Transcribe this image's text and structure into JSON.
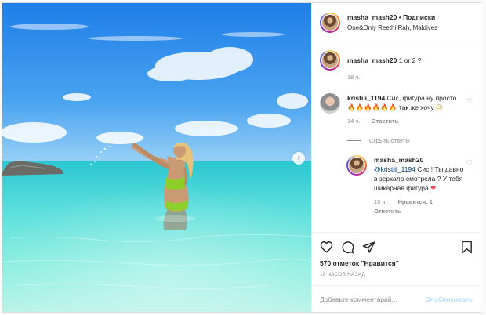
{
  "header": {
    "username": "masha_mash20",
    "separator": "•",
    "follow_label": "Подписки",
    "location": "One&Only Reethi Rah, Maldives"
  },
  "caption": {
    "username": "masha_mash20",
    "text": "1 or 2 ?",
    "time": "18 ч."
  },
  "comments": [
    {
      "username": "kristiii_1194",
      "text_before": "Сис, фигура ну просто",
      "emoji": "🔥🔥🔥🔥🔥🔥",
      "text_after": "так же хочу",
      "emoji_end": "😉",
      "time": "14 ч.",
      "reply_label": "Ответить"
    }
  ],
  "replies_toggle": "Скрыть ответы",
  "reply": {
    "username": "masha_mash20",
    "mention": "@kristiii_1194",
    "text": "Сис ! Ты давно в зеркало смотрела ? У тебя шикарная фигура",
    "emoji": "❤",
    "time": "15 ч.",
    "likes_label": "Нравится: 1",
    "reply_label": "Ответить"
  },
  "likes_text": "570 отметок \"Нравится\"",
  "post_time": "18 ЧАСОВ НАЗАД",
  "add_comment": {
    "placeholder": "Добавьте комментарий...",
    "publish_label": "Опубликовать"
  },
  "icons": {
    "like": "heart-icon",
    "comment": "comment-icon",
    "share": "share-icon",
    "save": "bookmark-icon",
    "next": "chevron-right-icon",
    "comment_like": "heart-icon"
  },
  "colors": {
    "link": "#00376b",
    "muted": "#8e8e8e",
    "publish_disabled": "#b2dffc",
    "heart_red": "#ed4956"
  }
}
